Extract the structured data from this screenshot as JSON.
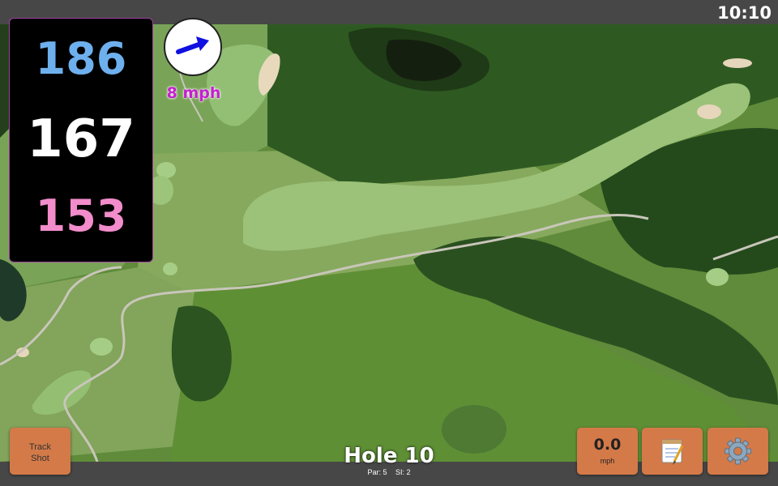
{
  "status": {
    "time": "10:10"
  },
  "distances": {
    "back": "186",
    "middle": "167",
    "front": "153"
  },
  "wind": {
    "speed": "8 mph",
    "icon": "wind-direction-arrow-icon"
  },
  "hole": {
    "title": "Hole 10",
    "par": "Par: 5",
    "stroke_index": "SI: 2"
  },
  "buttons": {
    "track_shot": [
      "Track",
      "Shot"
    ],
    "speed_value": "0.0",
    "speed_unit": "mph",
    "notes_icon": "notepad-icon",
    "settings_icon": "gear-icon"
  },
  "colors": {
    "back": "#6eb0ee",
    "middle": "#ffffff",
    "front": "#f28ccb",
    "wind_text": "#c51fd0",
    "button": "#d37a48"
  }
}
